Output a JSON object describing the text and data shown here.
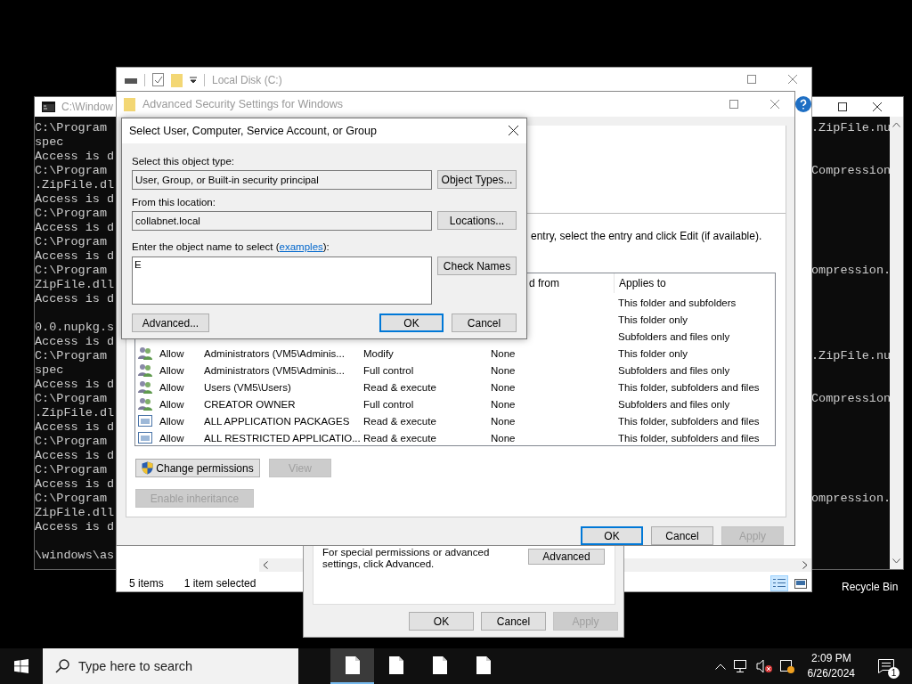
{
  "cmd_window": {
    "title": "C:\\Window",
    "left_blocks": [
      [
        "C:\\Program",
        "spec",
        "Access is d",
        "C:\\Program",
        ".ZipFile.dl",
        "Access is d",
        "C:\\Program",
        "Access is d",
        "C:\\Program",
        "Access is d",
        "C:\\Program",
        "ZipFile.dll",
        "Access is d"
      ],
      [
        "0.0.nupkg.s",
        "Access is d",
        "C:\\Program",
        "spec",
        "Access is d",
        "C:\\Program",
        ".ZipFile.dl",
        "Access is d",
        "C:\\Program",
        "Access is d",
        "C:\\Program",
        "Access is d",
        "C:\\Program",
        "ZipFile.dll",
        "Access is d"
      ],
      [
        "\\windows\\as"
      ]
    ],
    "right_lines": [
      ".ZipFile.nu",
      "Compression",
      "ompression.",
      ".ZipFile.nu",
      "Compression",
      "ompression."
    ]
  },
  "explorer": {
    "title": "Local Disk (C:)",
    "status_items": "5 items",
    "status_selected": "1 item selected",
    "views": [
      {
        "kind": "details",
        "selected": true
      },
      {
        "kind": "icons",
        "selected": false
      }
    ]
  },
  "properties": {
    "note": "For special permissions or advanced settings, click Advanced.",
    "advanced_button": "Advanced",
    "buttons": [
      {
        "label": "OK",
        "disabled": false
      },
      {
        "label": "Cancel",
        "disabled": false
      },
      {
        "label": "Apply",
        "disabled": true
      }
    ]
  },
  "security": {
    "title": "Advanced Security Settings for Windows",
    "instruction": "entry, select the entry and click Edit (if available).",
    "columns": {
      "inherited": "d from",
      "applies": "Applies to"
    },
    "entries": [
      {
        "applies": "This folder and subfolders"
      },
      {
        "applies": "This folder only"
      },
      {
        "applies": "Subfolders and files only"
      },
      {
        "kind": "group",
        "type": "Allow",
        "principal": "Administrators (VM5\\Adminis...",
        "access": "Modify",
        "inherited": "None",
        "applies": "This folder only"
      },
      {
        "kind": "group",
        "type": "Allow",
        "principal": "Administrators (VM5\\Adminis...",
        "access": "Full control",
        "inherited": "None",
        "applies": "Subfolders and files only"
      },
      {
        "kind": "group",
        "type": "Allow",
        "principal": "Users (VM5\\Users)",
        "access": "Read & execute",
        "inherited": "None",
        "applies": "This folder, subfolders and files"
      },
      {
        "kind": "group",
        "type": "Allow",
        "principal": "CREATOR OWNER",
        "access": "Full control",
        "inherited": "None",
        "applies": "Subfolders and files only"
      },
      {
        "kind": "package",
        "type": "Allow",
        "principal": "ALL APPLICATION PACKAGES",
        "access": "Read & execute",
        "inherited": "None",
        "applies": "This folder, subfolders and files"
      },
      {
        "kind": "package",
        "type": "Allow",
        "principal": "ALL RESTRICTED APPLICATIO...",
        "access": "Read & execute",
        "inherited": "None",
        "applies": "This folder, subfolders and files"
      }
    ],
    "actions": [
      {
        "label": "Change permissions",
        "disabled": false,
        "shield": true
      },
      {
        "label": "View",
        "disabled": true,
        "shield": false
      }
    ],
    "inheritance_button": {
      "label": "Enable inheritance",
      "disabled": true
    },
    "buttons": [
      {
        "label": "OK",
        "disabled": false,
        "default": true
      },
      {
        "label": "Cancel",
        "disabled": false,
        "default": false
      },
      {
        "label": "Apply",
        "disabled": true,
        "default": false
      }
    ]
  },
  "select_dialog": {
    "title": "Select User, Computer, Service Account, or Group",
    "object_type_label": "Select this object type:",
    "object_type": "User, Group, or Built-in security principal",
    "object_types_button": "Object Types...",
    "location_label": "From this location:",
    "location": "collabnet.local",
    "locations_button": "Locations...",
    "name_label": {
      "before": "Enter the object name to select (",
      "link": "examples",
      "after": "):"
    },
    "name_value": "E",
    "check_names_button": "Check Names",
    "buttons": [
      {
        "label": "Advanced...",
        "disabled": false,
        "default": false
      },
      {
        "label": "OK",
        "disabled": false,
        "default": true
      },
      {
        "label": "Cancel",
        "disabled": false,
        "default": false
      }
    ]
  },
  "desktop": {
    "recycle_bin": "Recycle Bin"
  },
  "taskbar": {
    "search": {
      "placeholder": "Type here to search"
    },
    "apps": [
      {
        "selected": true
      },
      {
        "selected": false
      },
      {
        "selected": false
      },
      {
        "selected": false
      }
    ],
    "time": "2:09 PM",
    "date": "6/26/2024",
    "notifications": "1"
  }
}
